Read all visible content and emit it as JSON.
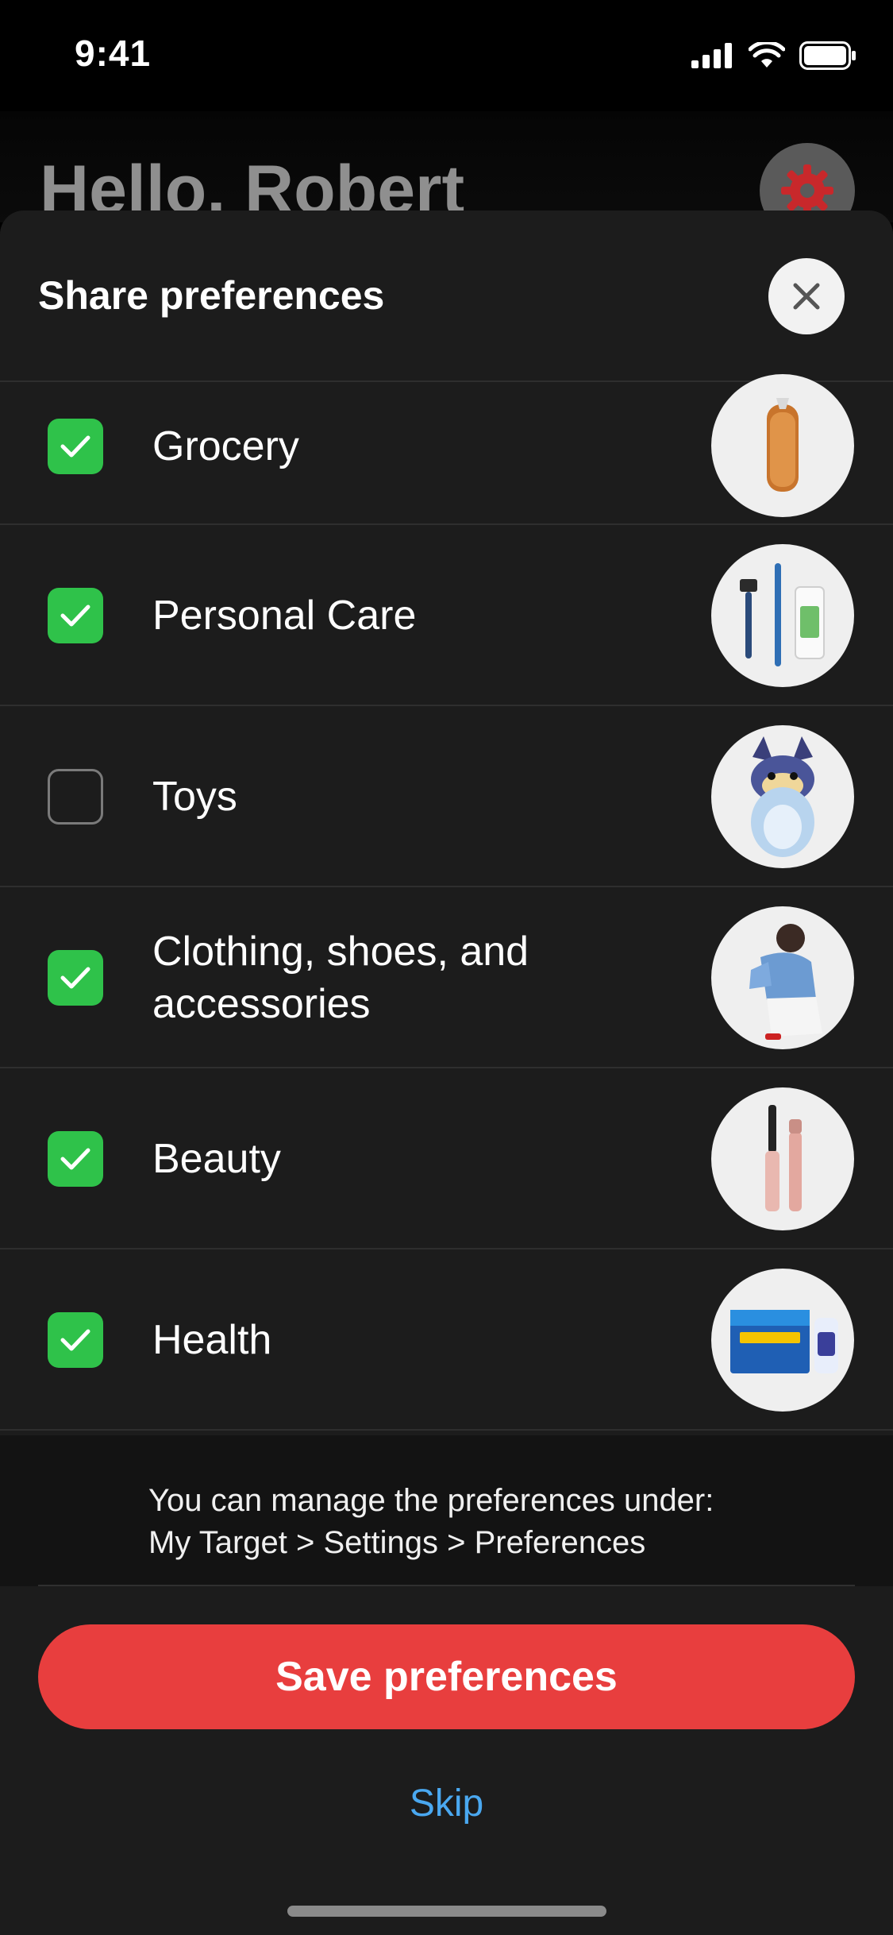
{
  "status_bar": {
    "time": "9:41"
  },
  "background": {
    "greeting": "Hello, Robert"
  },
  "sheet": {
    "title": "Share preferences",
    "preferences": [
      {
        "label": "Grocery",
        "checked": true,
        "icon": "bread-product-image"
      },
      {
        "label": "Personal Care",
        "checked": true,
        "icon": "razor-toothbrush-deodorant-image"
      },
      {
        "label": "Toys",
        "checked": false,
        "icon": "plush-dog-toy-image"
      },
      {
        "label": "Clothing, shoes, and accessories",
        "checked": true,
        "icon": "fashion-model-image"
      },
      {
        "label": "Beauty",
        "checked": true,
        "icon": "mascara-image"
      },
      {
        "label": "Health",
        "checked": true,
        "icon": "tampax-box-image"
      }
    ],
    "info": {
      "line1": "You can manage the preferences under:",
      "line2": "My Target > Settings > Preferences"
    },
    "save_label": "Save preferences",
    "skip_label": "Skip"
  },
  "colors": {
    "accent": "#e83e3e",
    "check_green": "#2fc24a",
    "link_blue": "#4aa8f0",
    "sheet_bg": "#1c1c1c"
  }
}
